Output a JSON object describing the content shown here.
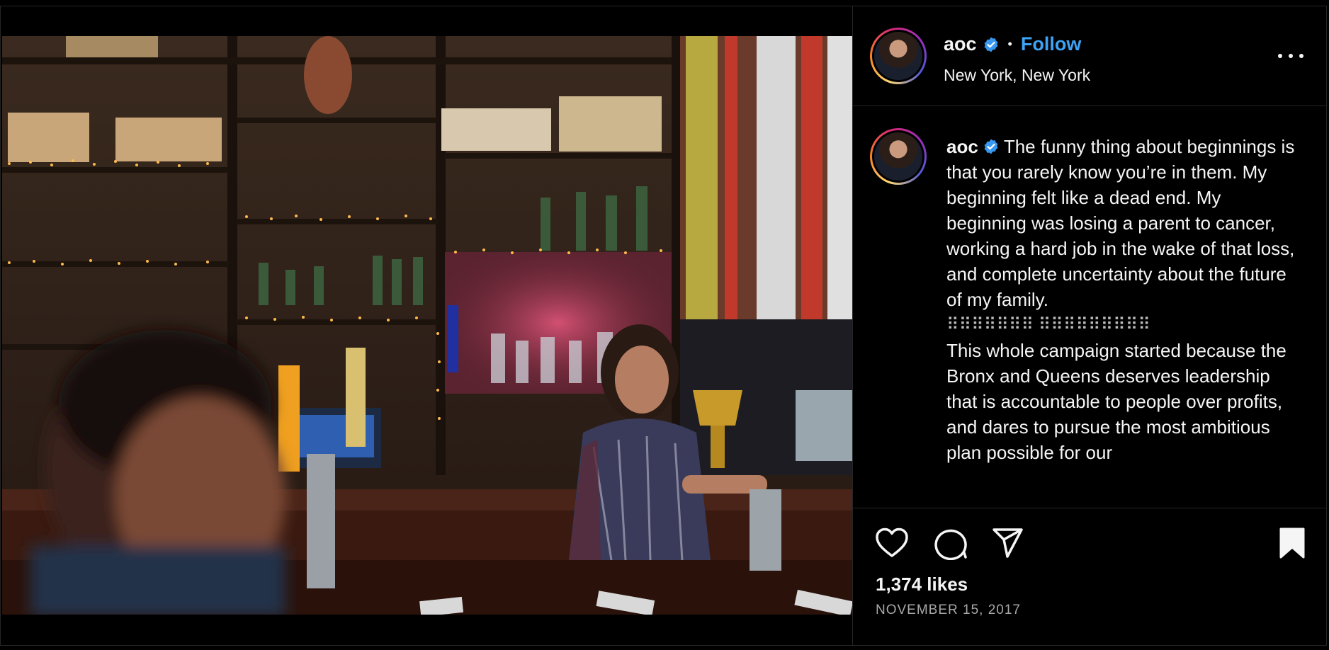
{
  "post": {
    "username": "aoc",
    "separator": "•",
    "follow_label": "Follow",
    "location": "New York, New York",
    "caption_paragraphs": [
      "The funny thing about beginnings is that you rarely know you’re in them. My beginning felt like a dead end. My beginning was losing a parent to cancer, working a hard job in the wake of that loss, and complete uncertainty about the future of my family.",
      "⠿⠿⠿⠿⠿⠿⠿ ⠿⠿⠿⠿⠿⠿⠿⠿⠿",
      "This whole campaign started because the Bronx and Queens deserves leadership that is accountable to people over profits, and dares to pursue the most ambitious plan possible for our"
    ],
    "likes": "1,374 likes",
    "date": "NOVEMBER 15, 2017"
  },
  "icons": {
    "verified": "verified-badge-icon",
    "more": "more-options-icon",
    "like": "heart-icon",
    "comment": "comment-icon",
    "share": "paper-plane-icon",
    "save": "bookmark-icon"
  },
  "colors": {
    "follow": "#3ea3f5",
    "verified": "#3897f0",
    "background": "#000000",
    "divider": "#262626",
    "muted": "#a8a8a8"
  }
}
